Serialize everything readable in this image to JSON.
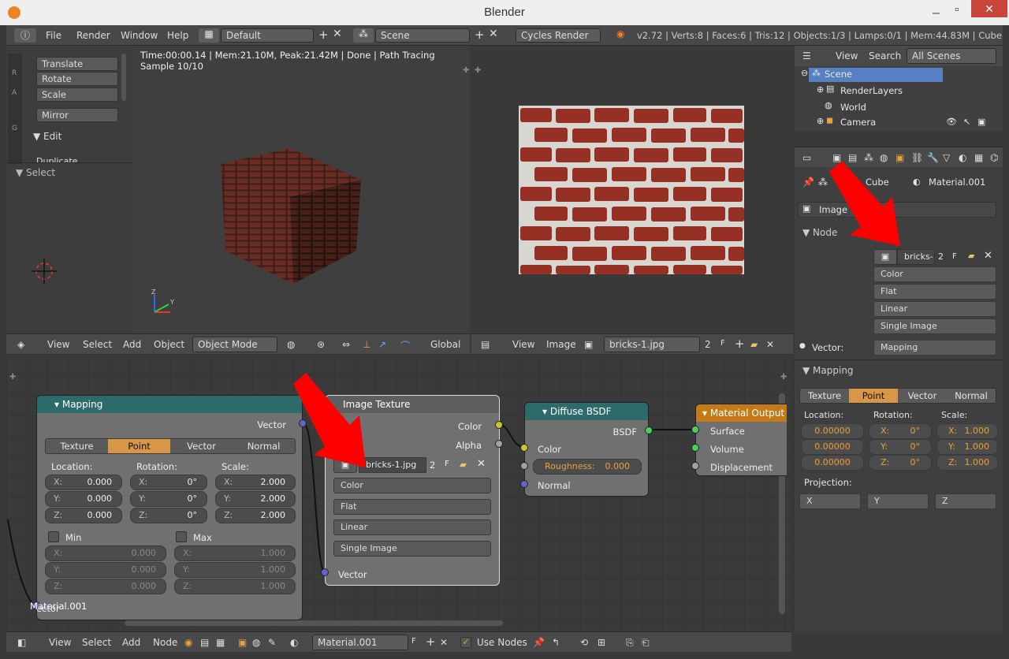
{
  "window": {
    "title": "Blender"
  },
  "topmenu": {
    "items": [
      "File",
      "Render",
      "Window",
      "Help"
    ],
    "layout": "Default",
    "scene": "Scene",
    "engine": "Cycles Render",
    "stats": "v2.72 | Verts:8 | Faces:6 | Tris:12 | Objects:1/3 | Lamps:0/1 | Mem:44.83M | Cube"
  },
  "toolshelf": {
    "buttons": [
      "Translate",
      "Rotate",
      "Scale",
      "Mirror"
    ],
    "edit": "Edit",
    "duplicate": "Duplicate",
    "select": "Select",
    "tabs": [
      "R",
      "A",
      "G"
    ]
  },
  "viewport": {
    "status": "Time:00:00.14 | Mem:21.10M, Peak:21.42M | Done | Path Tracing Sample 10/10",
    "header": [
      "View",
      "Select",
      "Add",
      "Object"
    ],
    "mode": "Object Mode",
    "orientation": "Global"
  },
  "imgedit": {
    "header": [
      "View",
      "Image"
    ],
    "image": "bricks-1.jpg",
    "users": "2",
    "fake": "F"
  },
  "outliner": {
    "header": [
      "View",
      "Search"
    ],
    "filter": "All Scenes",
    "items": [
      "Scene",
      "RenderLayers",
      "World",
      "Camera"
    ]
  },
  "props": {
    "object": "Cube",
    "material": "Material.001",
    "type": "Image Texture",
    "node_panel": "Node",
    "image": "bricks-",
    "users": "2",
    "fake": "F",
    "selects": [
      "Color",
      "Flat",
      "Linear",
      "Single Image"
    ],
    "vector_label": "Vector:",
    "vector_value": "Mapping",
    "mapping_panel": "Mapping",
    "tabs": [
      "Texture",
      "Point",
      "Vector",
      "Normal"
    ],
    "loc_label": "Location:",
    "rot_label": "Rotation:",
    "scale_label": "Scale:",
    "loc": [
      "0.00000",
      "0.00000",
      "0.00000"
    ],
    "rot": [
      "X:",
      "0°",
      "Y:",
      "0°",
      "Z:",
      "0°"
    ],
    "scale": [
      "X:",
      "1.000",
      "Y:",
      "1.000",
      "Z:",
      "1.000"
    ],
    "projection_label": "Projection:",
    "projection": [
      "X",
      "Y",
      "Z"
    ]
  },
  "nodes": {
    "mapping": {
      "title": "Mapping",
      "output": "Vector",
      "tabs": [
        "Texture",
        "Point",
        "Vector",
        "Normal"
      ],
      "loc_label": "Location:",
      "rot_label": "Rotation:",
      "scale_label": "Scale:",
      "loc": [
        "0.000",
        "0.000",
        "0.000"
      ],
      "rot": [
        "0°",
        "0°",
        "0°"
      ],
      "scale": [
        "2.000",
        "2.000",
        "2.000"
      ],
      "min": "Min",
      "max": "Max",
      "min_vals": [
        "0.000",
        "0.000",
        "0.000"
      ],
      "max_vals": [
        "1.000",
        "1.000",
        "1.000"
      ],
      "input": "Vector"
    },
    "imgtex": {
      "title": "Image Texture",
      "out_color": "Color",
      "out_alpha": "Alpha",
      "image": "bricks-1.jpg",
      "users": "2",
      "fake": "F",
      "selects": [
        "Color",
        "Flat",
        "Linear",
        "Single Image"
      ],
      "input": "Vector"
    },
    "diffuse": {
      "title": "Diffuse BSDF",
      "output": "BSDF",
      "color": "Color",
      "roughness_label": "Roughness:",
      "roughness": "0.000",
      "normal": "Normal"
    },
    "output": {
      "title": "Material Output",
      "inputs": [
        "Surface",
        "Volume",
        "Displacement"
      ]
    }
  },
  "nodeheader": {
    "items": [
      "View",
      "Select",
      "Add",
      "Node"
    ],
    "material": "Material.001",
    "fake": "F",
    "use_nodes": "Use Nodes",
    "frame_label": "Material.001"
  },
  "axes": {
    "x": "X",
    "y": "Y",
    "z": "Z"
  }
}
